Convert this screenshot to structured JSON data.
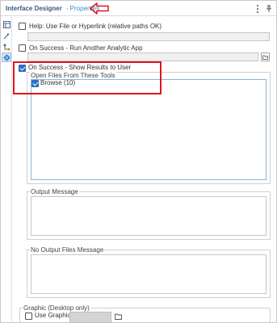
{
  "panel": {
    "title": "Interface Designer",
    "separator": "-",
    "subtitle": "Properties"
  },
  "help": {
    "label": "Help: Use File or Hyperlink (relative paths OK)",
    "checked": false,
    "value": ""
  },
  "run_app": {
    "label": "On Success - Run Another Analytic App",
    "checked": false,
    "value": ""
  },
  "show_results": {
    "label": "On Success - Show Results to User",
    "checked": true,
    "group_title": "Open Files From These Tools",
    "tools": [
      {
        "label": "Browse (10)",
        "checked": true
      }
    ]
  },
  "output_message": {
    "title": "Output Message",
    "value": ""
  },
  "no_output_message": {
    "title": "No Output Files Message",
    "value": ""
  },
  "graphic": {
    "title": "Graphic (Desktop only)",
    "use_label": "Use Graphic:",
    "checked": false
  },
  "icons": {
    "menu": "vertical-ellipsis-icon",
    "pin": "pin-icon",
    "strip": [
      "tree-view-icon",
      "wand-icon",
      "actions-icon",
      "gear-icon"
    ],
    "folder": "folder-icon",
    "arrow": "left-arrow-annotation-icon"
  },
  "colors": {
    "accent": "#2c6fbf",
    "annotation": "#e0151b",
    "title": "#3a5a80",
    "subtitle": "#3a8ad3"
  }
}
